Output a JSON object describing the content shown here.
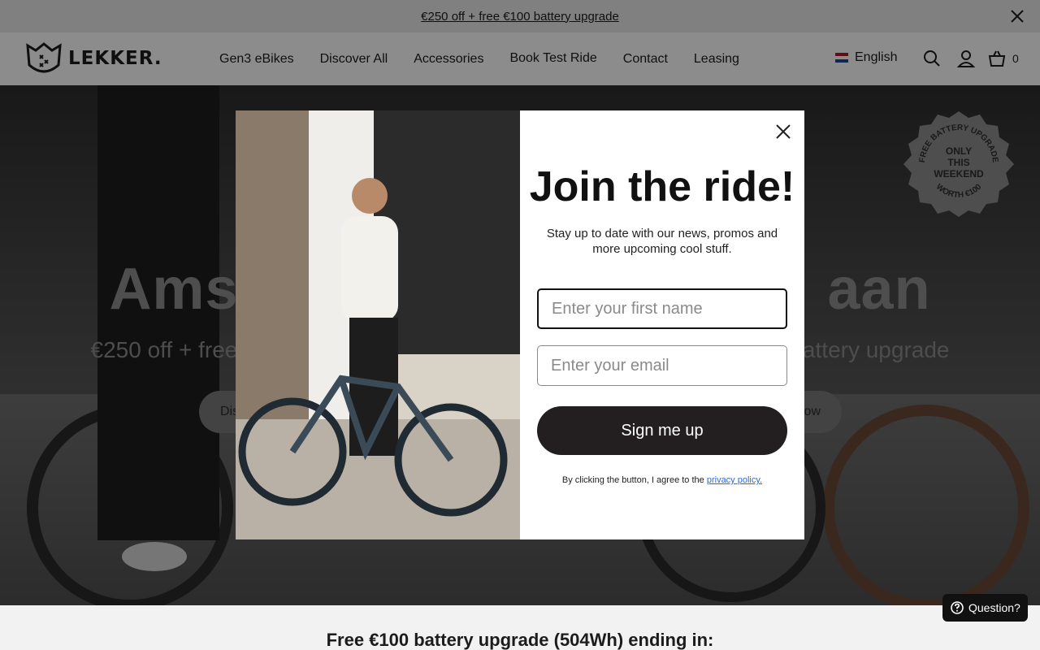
{
  "announcement": {
    "text": "€250 off + free €100 battery upgrade"
  },
  "header": {
    "logo_text": "LEKKER.",
    "nav": [
      "Gen3 eBikes",
      "Discover All",
      "Accessories",
      "Book Test Ride",
      "Contact",
      "Leasing"
    ],
    "language": "English",
    "cart_count": "0"
  },
  "hero": {
    "title_left": "Amst",
    "title_right": "aan",
    "subtitle_left": "€250 off + free",
    "subtitle_right": "battery upgrade",
    "button_left": "Dis",
    "button_right": "ow",
    "badge": {
      "arc_top": "FREE BATTERY UPGRADE",
      "line1": "ONLY",
      "line2": "THIS",
      "line3": "WEEKEND",
      "arc_bottom": "WORTH €100"
    }
  },
  "popup": {
    "title": "Join the ride!",
    "description": "Stay up to date with our news, promos and more upcoming cool stuff.",
    "first_name_placeholder": "Enter your first name",
    "email_placeholder": "Enter your email",
    "submit_label": "Sign me up",
    "consent_text": "By clicking the button, I agree to the ",
    "privacy_link": "privacy policy."
  },
  "bottom": {
    "countdown_text": "Free €100 battery upgrade (504Wh) ending in:"
  },
  "chat": {
    "label": "Question?"
  },
  "colors": {
    "accent_dark": "#231f20",
    "link": "#2b6bd6",
    "flag_red": "#ae1c28",
    "flag_white": "#ffffff",
    "flag_blue": "#21468b"
  }
}
